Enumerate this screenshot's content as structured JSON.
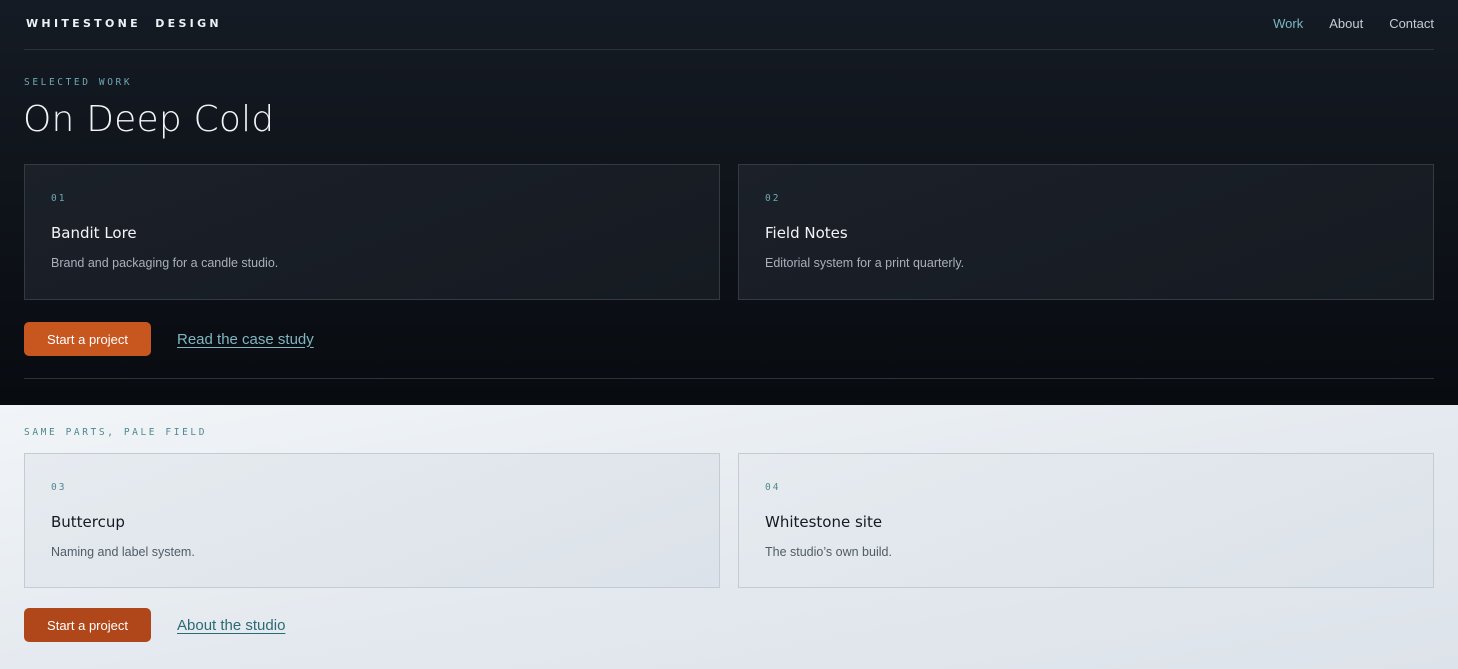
{
  "header": {
    "brand": "WHITESTONE  DESIGN",
    "nav": [
      {
        "label": "Work",
        "active": true
      },
      {
        "label": "About",
        "active": false
      },
      {
        "label": "Contact",
        "active": false
      }
    ]
  },
  "dark_section": {
    "eyebrow": "SELECTED WORK",
    "title": "On Deep Cold",
    "cards": [
      {
        "num": "01",
        "title": "Bandit Lore",
        "desc": "Brand and packaging for a candle studio."
      },
      {
        "num": "02",
        "title": "Field Notes",
        "desc": "Editorial system for a print quarterly."
      }
    ],
    "cta_label": "Start a project",
    "link_label": "Read the case study"
  },
  "light_section": {
    "eyebrow": "SAME PARTS, PALE FIELD",
    "cards": [
      {
        "num": "03",
        "title": "Buttercup",
        "desc": "Naming and label system."
      },
      {
        "num": "04",
        "title": "Whitestone site",
        "desc": "The studio’s own build."
      }
    ],
    "cta_label": "Start a project",
    "link_label": "About the studio"
  },
  "colors": {
    "accent_orange": "#c8561f",
    "accent_orange_light_section": "#b0471a",
    "accent_teal": "#7bb7c2",
    "dark_bg": "#10151c",
    "light_bg": "#e4e9ef"
  }
}
